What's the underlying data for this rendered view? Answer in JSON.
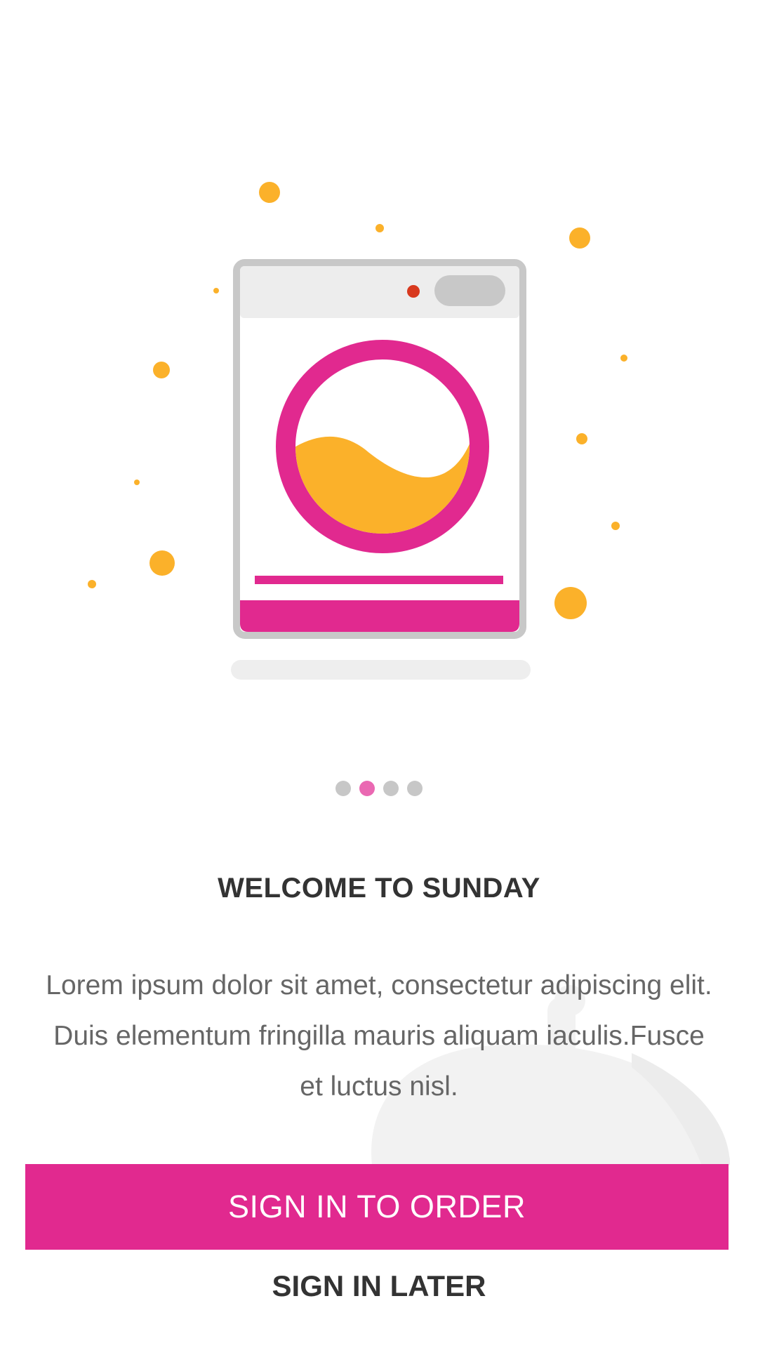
{
  "onboarding": {
    "title": "WELCOME TO SUNDAY",
    "body": "Lorem ipsum dolor sit amet, consectetur adipiscing elit. Duis elementum fringilla mauris aliquam iaculis.Fusce et luctus nisl.",
    "pager": {
      "total": 4,
      "current": 2
    }
  },
  "actions": {
    "primary_label": "SIGN IN TO ORDER",
    "secondary_label": "SIGN IN LATER"
  },
  "colors": {
    "accent": "#e1298f",
    "bubble": "#fbb12a",
    "indicator_light": "#d8391e",
    "pager_active": "#ea68b2",
    "pager_inactive": "#c7c7c7"
  }
}
